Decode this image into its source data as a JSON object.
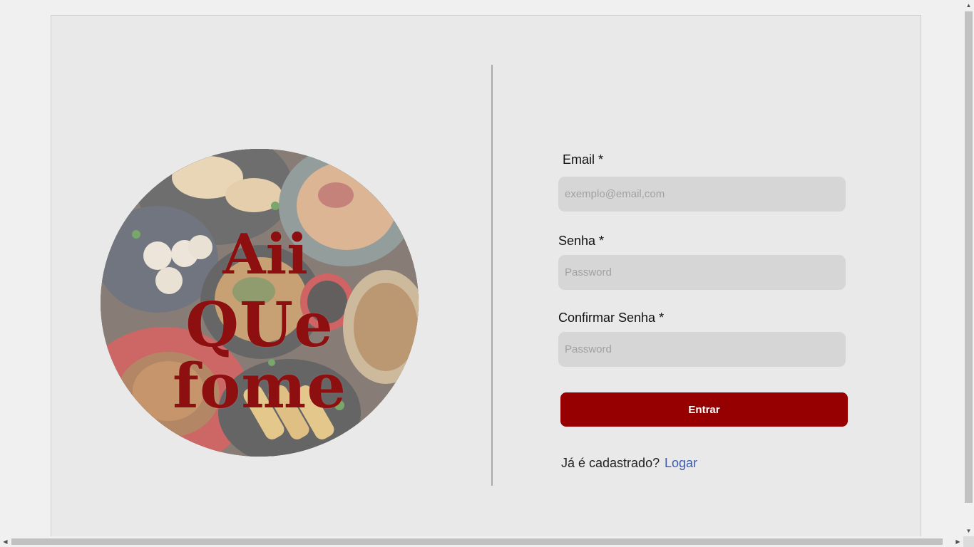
{
  "logo": {
    "line1": "Aii",
    "line2": "QUe fome"
  },
  "form": {
    "email_label": "Email *",
    "email_placeholder": "exemplo@email,com",
    "password_label": "Senha *",
    "password_placeholder": "Password",
    "confirm_label": "Confirmar Senha *",
    "confirm_placeholder": "Password",
    "submit_label": "Entrar",
    "register_prompt": "Já é cadastrado?",
    "login_link": "Logar"
  },
  "colors": {
    "accent": "#960000",
    "logo_text": "#8e0f0f",
    "link": "#3b5cae",
    "input_bg": "#d6d6d6",
    "card_bg": "#e9e9e9"
  }
}
